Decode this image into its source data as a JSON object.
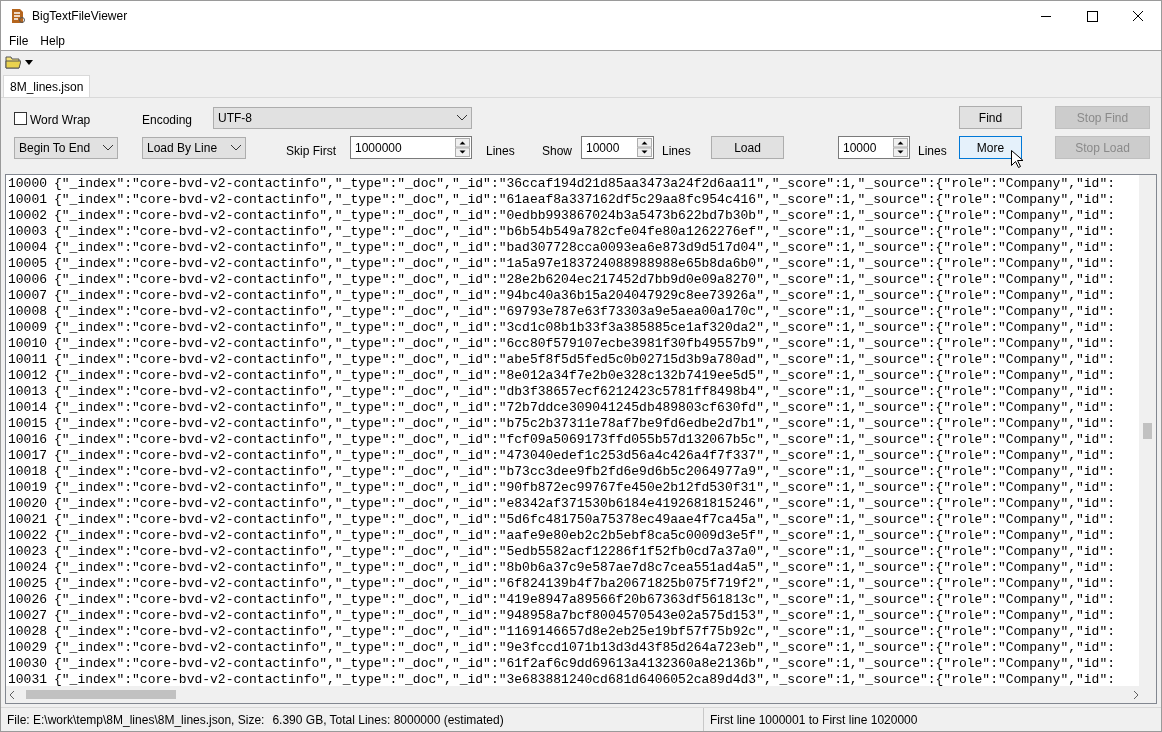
{
  "window": {
    "title": "BigTextFileViewer"
  },
  "menu": [
    {
      "label": "File"
    },
    {
      "label": "Help"
    }
  ],
  "tabs": [
    {
      "label": "8M_lines.json",
      "selected": true
    }
  ],
  "options": {
    "word_wrap": {
      "label": "Word Wrap",
      "checked": false
    },
    "encoding": {
      "label": "Encoding",
      "value": "UTF-8"
    },
    "direction": {
      "value": "Begin To End"
    },
    "mode": {
      "value": "Load By Line"
    },
    "skip": {
      "label": "Skip First",
      "value": "1000000",
      "unit": "Lines"
    },
    "show": {
      "label": "Show",
      "value": "10000",
      "unit": "Lines"
    },
    "more_count": {
      "value": "10000",
      "unit": "Lines"
    }
  },
  "buttons": [
    {
      "label": "Find",
      "disabled": false,
      "hovered": false
    },
    {
      "label": "Stop Find",
      "disabled": true,
      "hovered": false
    },
    {
      "label": "Load",
      "disabled": false,
      "hovered": false
    },
    {
      "label": "More",
      "disabled": false,
      "hovered": true
    },
    {
      "label": "Stop Load",
      "disabled": true,
      "hovered": false
    }
  ],
  "lines": [
    {
      "number": "10000",
      "text": "{\"_index\":\"core-bvd-v2-contactinfo\",\"_type\":\"_doc\",\"_id\":\"36ccaf194d21d85aa3473a24f2d6aa11\",\"_score\":1,\"_source\":{\"role\":\"Company\",\"id\":"
    },
    {
      "number": "10001",
      "text": "{\"_index\":\"core-bvd-v2-contactinfo\",\"_type\":\"_doc\",\"_id\":\"61aeaf8a337162df5c29aa8fc954c416\",\"_score\":1,\"_source\":{\"role\":\"Company\",\"id\":"
    },
    {
      "number": "10002",
      "text": "{\"_index\":\"core-bvd-v2-contactinfo\",\"_type\":\"_doc\",\"_id\":\"0edbb993867024b3a5473b622bd7b30b\",\"_score\":1,\"_source\":{\"role\":\"Company\",\"id\":"
    },
    {
      "number": "10003",
      "text": "{\"_index\":\"core-bvd-v2-contactinfo\",\"_type\":\"_doc\",\"_id\":\"b6b54b549a782cfe04fe80a1262276ef\",\"_score\":1,\"_source\":{\"role\":\"Company\",\"id\":"
    },
    {
      "number": "10004",
      "text": "{\"_index\":\"core-bvd-v2-contactinfo\",\"_type\":\"_doc\",\"_id\":\"bad307728cca0093ea6e873d9d517d04\",\"_score\":1,\"_source\":{\"role\":\"Company\",\"id\":"
    },
    {
      "number": "10005",
      "text": "{\"_index\":\"core-bvd-v2-contactinfo\",\"_type\":\"_doc\",\"_id\":\"1a5a97e183724088988988e65b8da6b0\",\"_score\":1,\"_source\":{\"role\":\"Company\",\"id\":"
    },
    {
      "number": "10006",
      "text": "{\"_index\":\"core-bvd-v2-contactinfo\",\"_type\":\"_doc\",\"_id\":\"28e2b6204ec217452d7bb9d0e09a8270\",\"_score\":1,\"_source\":{\"role\":\"Company\",\"id\":"
    },
    {
      "number": "10007",
      "text": "{\"_index\":\"core-bvd-v2-contactinfo\",\"_type\":\"_doc\",\"_id\":\"94bc40a36b15a204047929c8ee73926a\",\"_score\":1,\"_source\":{\"role\":\"Company\",\"id\":"
    },
    {
      "number": "10008",
      "text": "{\"_index\":\"core-bvd-v2-contactinfo\",\"_type\":\"_doc\",\"_id\":\"69793e787e63f73303a9e5aea00a170c\",\"_score\":1,\"_source\":{\"role\":\"Company\",\"id\":"
    },
    {
      "number": "10009",
      "text": "{\"_index\":\"core-bvd-v2-contactinfo\",\"_type\":\"_doc\",\"_id\":\"3cd1c08b1b33f3a385885ce1af320da2\",\"_score\":1,\"_source\":{\"role\":\"Company\",\"id\":"
    },
    {
      "number": "10010",
      "text": "{\"_index\":\"core-bvd-v2-contactinfo\",\"_type\":\"_doc\",\"_id\":\"6cc80f579107ecbe3981f30fb49557b9\",\"_score\":1,\"_source\":{\"role\":\"Company\",\"id\":"
    },
    {
      "number": "10011",
      "text": "{\"_index\":\"core-bvd-v2-contactinfo\",\"_type\":\"_doc\",\"_id\":\"abe5f8f5d5fed5c0b02715d3b9a780ad\",\"_score\":1,\"_source\":{\"role\":\"Company\",\"id\":"
    },
    {
      "number": "10012",
      "text": "{\"_index\":\"core-bvd-v2-contactinfo\",\"_type\":\"_doc\",\"_id\":\"8e012a34f7e2b0e328c132b7419ee5d5\",\"_score\":1,\"_source\":{\"role\":\"Company\",\"id\":"
    },
    {
      "number": "10013",
      "text": "{\"_index\":\"core-bvd-v2-contactinfo\",\"_type\":\"_doc\",\"_id\":\"db3f38657ecf6212423c5781ff8498b4\",\"_score\":1,\"_source\":{\"role\":\"Company\",\"id\":"
    },
    {
      "number": "10014",
      "text": "{\"_index\":\"core-bvd-v2-contactinfo\",\"_type\":\"_doc\",\"_id\":\"72b7ddce309041245db489803cf630fd\",\"_score\":1,\"_source\":{\"role\":\"Company\",\"id\":"
    },
    {
      "number": "10015",
      "text": "{\"_index\":\"core-bvd-v2-contactinfo\",\"_type\":\"_doc\",\"_id\":\"b75c2b37311e78af7be9fd6edbe2d7b1\",\"_score\":1,\"_source\":{\"role\":\"Company\",\"id\":"
    },
    {
      "number": "10016",
      "text": "{\"_index\":\"core-bvd-v2-contactinfo\",\"_type\":\"_doc\",\"_id\":\"fcf09a5069173ffd055b57d132067b5c\",\"_score\":1,\"_source\":{\"role\":\"Company\",\"id\":"
    },
    {
      "number": "10017",
      "text": "{\"_index\":\"core-bvd-v2-contactinfo\",\"_type\":\"_doc\",\"_id\":\"473040edef1c253d56a4c426a4f7f337\",\"_score\":1,\"_source\":{\"role\":\"Company\",\"id\":"
    },
    {
      "number": "10018",
      "text": "{\"_index\":\"core-bvd-v2-contactinfo\",\"_type\":\"_doc\",\"_id\":\"b73cc3dee9fb2fd6e9d6b5c2064977a9\",\"_score\":1,\"_source\":{\"role\":\"Company\",\"id\":"
    },
    {
      "number": "10019",
      "text": "{\"_index\":\"core-bvd-v2-contactinfo\",\"_type\":\"_doc\",\"_id\":\"90fb872ec99767fe450e2b12fd530f31\",\"_score\":1,\"_source\":{\"role\":\"Company\",\"id\":"
    },
    {
      "number": "10020",
      "text": "{\"_index\":\"core-bvd-v2-contactinfo\",\"_type\":\"_doc\",\"_id\":\"e8342af371530b6184e4192681815246\",\"_score\":1,\"_source\":{\"role\":\"Company\",\"id\":"
    },
    {
      "number": "10021",
      "text": "{\"_index\":\"core-bvd-v2-contactinfo\",\"_type\":\"_doc\",\"_id\":\"5d6fc481750a75378ec49aae4f7ca45a\",\"_score\":1,\"_source\":{\"role\":\"Company\",\"id\":"
    },
    {
      "number": "10022",
      "text": "{\"_index\":\"core-bvd-v2-contactinfo\",\"_type\":\"_doc\",\"_id\":\"aafe9e80eb2c2b5ebf8ca5c0009d3e5f\",\"_score\":1,\"_source\":{\"role\":\"Company\",\"id\":"
    },
    {
      "number": "10023",
      "text": "{\"_index\":\"core-bvd-v2-contactinfo\",\"_type\":\"_doc\",\"_id\":\"5edb5582acf12286f1f52fb0cd7a37a0\",\"_score\":1,\"_source\":{\"role\":\"Company\",\"id\":"
    },
    {
      "number": "10024",
      "text": "{\"_index\":\"core-bvd-v2-contactinfo\",\"_type\":\"_doc\",\"_id\":\"8b0b6a37c9e587ae7d8c7cea551ad4a5\",\"_score\":1,\"_source\":{\"role\":\"Company\",\"id\":"
    },
    {
      "number": "10025",
      "text": "{\"_index\":\"core-bvd-v2-contactinfo\",\"_type\":\"_doc\",\"_id\":\"6f824139b4f7ba20671825b075f719f2\",\"_score\":1,\"_source\":{\"role\":\"Company\",\"id\":"
    },
    {
      "number": "10026",
      "text": "{\"_index\":\"core-bvd-v2-contactinfo\",\"_type\":\"_doc\",\"_id\":\"419e8947a89566f20b67363df561813c\",\"_score\":1,\"_source\":{\"role\":\"Company\",\"id\":"
    },
    {
      "number": "10027",
      "text": "{\"_index\":\"core-bvd-v2-contactinfo\",\"_type\":\"_doc\",\"_id\":\"948958a7bcf8004570543e02a575d153\",\"_score\":1,\"_source\":{\"role\":\"Company\",\"id\":"
    },
    {
      "number": "10028",
      "text": "{\"_index\":\"core-bvd-v2-contactinfo\",\"_type\":\"_doc\",\"_id\":\"1169146657d8e2eb25e19bf57f75b92c\",\"_score\":1,\"_source\":{\"role\":\"Company\",\"id\":"
    },
    {
      "number": "10029",
      "text": "{\"_index\":\"core-bvd-v2-contactinfo\",\"_type\":\"_doc\",\"_id\":\"9e3fccd1071b13d3d43f85d264a723eb\",\"_score\":1,\"_source\":{\"role\":\"Company\",\"id\":"
    },
    {
      "number": "10030",
      "text": "{\"_index\":\"core-bvd-v2-contactinfo\",\"_type\":\"_doc\",\"_id\":\"61f2af6c9dd69613a4132360a8e2136b\",\"_score\":1,\"_source\":{\"role\":\"Company\",\"id\":"
    },
    {
      "number": "10031",
      "text": "{\"_index\":\"core-bvd-v2-contactinfo\",\"_type\":\"_doc\",\"_id\":\"3e683881240cd681d6406052ca89d4d3\",\"_score\":1,\"_source\":{\"role\":\"Company\",\"id\":"
    }
  ],
  "status_bar": {
    "file": "File: E:\\work\\temp\\8M_lines\\8M_lines.json, Size:",
    "size": "6.390 GB, Total Lines: 8000000 (estimated)",
    "range": "First line 1000001 to First line 1020000"
  }
}
